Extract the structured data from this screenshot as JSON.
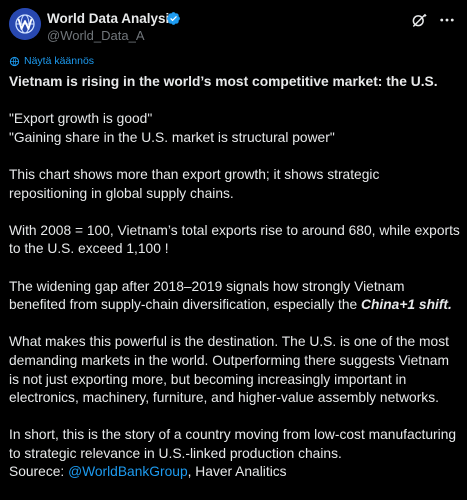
{
  "author": {
    "name": "World Data Analysis",
    "handle": "@World_Data_A"
  },
  "translate_label": "Näytä käännös",
  "post": {
    "headline": "Vietnam is rising in the world’s most competitive market: the U.S.",
    "quote1": "\"Export growth is good\"",
    "quote2": "\"Gaining share in the U.S. market is structural power\"",
    "para1": "This chart shows more than export growth; it shows strategic repositioning in global supply chains.",
    "para2": "With 2008 = 100, Vietnam’s total exports rise to around 680, while exports to the U.S. exceed 1,100 !",
    "para3_start": "The widening gap after 2018–2019 signals how strongly Vietnam benefited from supply-chain diversification, especially the ",
    "para3_emphasis": "China+1 shift.",
    "para4": "What makes this powerful is the destination. The U.S. is one of the most demanding markets in the world. Outperforming there suggests Vietnam is not just exporting more, but becoming increasingly important in electronics, machinery, furniture, and higher-value assembly networks.",
    "para5": "In short, this is the story of a country moving from low-cost manufacturing to strategic relevance in U.S.-linked production chains.",
    "source_label": "Sourece: ",
    "source_mention": "@WorldBankGroup",
    "source_rest": ", Haver Analitics"
  },
  "colors": {
    "background": "#000000",
    "text": "#e7e9ea",
    "secondary_text": "#71767b",
    "accent": "#1d9bf0"
  }
}
